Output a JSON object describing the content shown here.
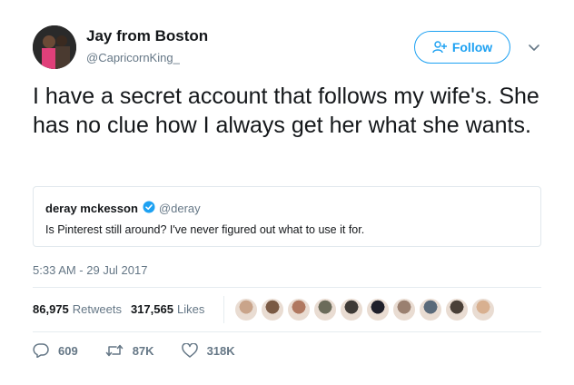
{
  "author": {
    "name": "Jay from Boston",
    "handle": "@CapricornKing_",
    "avatar_icon": "profile-photo"
  },
  "follow_button": {
    "label": "Follow",
    "icon": "add-user-icon",
    "color": "#1da1f2"
  },
  "menu_icon": "chevron-down-icon",
  "tweet": {
    "text": "I have a secret account that follows my wife's. She has no clue how I always get her what she wants."
  },
  "quoted_tweet": {
    "name": "deray mckesson",
    "handle": "@deray",
    "verified_icon": "verified-badge-icon",
    "text": "Is Pinterest still around? I've never figured out what to use it for."
  },
  "timestamp": "5:33 AM - 29 Jul 2017",
  "stats": {
    "retweets_count": "86,975",
    "retweets_label": "Retweets",
    "likes_count": "317,565",
    "likes_label": "Likes"
  },
  "likers": [
    {
      "color": "#c9a48a"
    },
    {
      "color": "#7a5a44"
    },
    {
      "color": "#b07860"
    },
    {
      "color": "#6b6b5a"
    },
    {
      "color": "#3e3a36"
    },
    {
      "color": "#1f1f2a"
    },
    {
      "color": "#9a8070"
    },
    {
      "color": "#5a6a7a"
    },
    {
      "color": "#4a4038"
    },
    {
      "color": "#d8b090"
    }
  ],
  "actions": {
    "reply_count": "609",
    "retweet_count": "87K",
    "like_count": "318K"
  },
  "colors": {
    "text": "#14171a",
    "secondary": "#657786",
    "accent": "#1da1f2",
    "border": "#e1e8ed"
  }
}
